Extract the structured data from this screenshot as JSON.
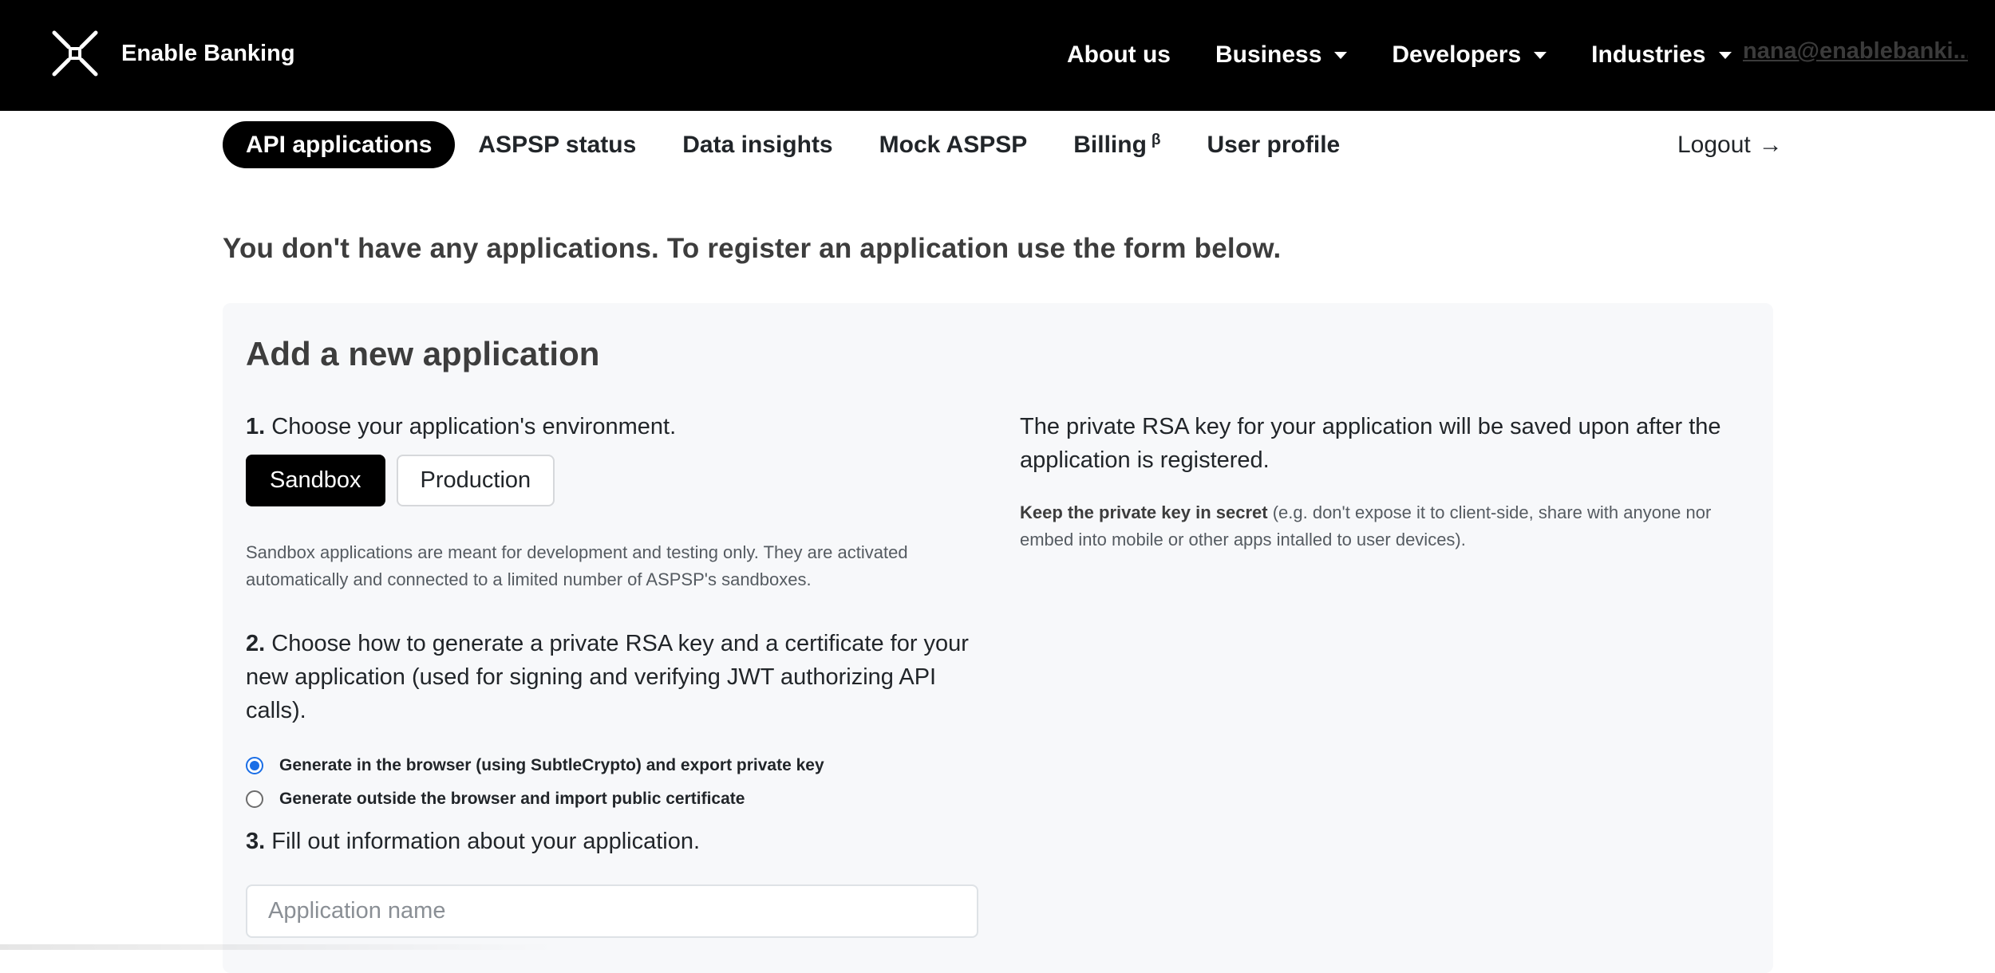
{
  "header": {
    "brand_name": "Enable Banking",
    "nav": [
      {
        "label": "About us",
        "has_caret": false
      },
      {
        "label": "Business",
        "has_caret": true
      },
      {
        "label": "Developers",
        "has_caret": true
      },
      {
        "label": "Industries",
        "has_caret": true
      }
    ],
    "user_email": "nana@enablebanki..."
  },
  "subnav": {
    "items": [
      {
        "label": "API applications",
        "active": true
      },
      {
        "label": "ASPSP status",
        "active": false
      },
      {
        "label": "Data insights",
        "active": false
      },
      {
        "label": "Mock ASPSP",
        "active": false
      },
      {
        "label": "Billing",
        "superscript": "β",
        "active": false
      },
      {
        "label": "User profile",
        "active": false
      }
    ],
    "logout_label": "Logout",
    "logout_arrow": "→"
  },
  "main": {
    "empty_message": "You don't have any applications. To register an application use the form below.",
    "form": {
      "title": "Add a new application",
      "step1": {
        "number": "1.",
        "text": "Choose your application's environment."
      },
      "environments": {
        "sandbox": "Sandbox",
        "production": "Production",
        "selected": "Sandbox"
      },
      "sandbox_help": "Sandbox applications are meant for development and testing only. They are activated automatically and connected to a limited number of ASPSP's sandboxes.",
      "step2": {
        "number": "2.",
        "text": "Choose how to generate a private RSA key and a certificate for your new application (used for signing and verifying JWT authorizing API calls)."
      },
      "key_options": [
        {
          "label": "Generate in the browser (using SubtleCrypto) and export private key",
          "checked": true
        },
        {
          "label": "Generate outside the browser and import public certificate",
          "checked": false
        }
      ],
      "step3": {
        "number": "3.",
        "text": "Fill out information about your application."
      },
      "app_name": {
        "value": "",
        "placeholder": "Application name"
      },
      "rsa_note": "The private RSA key for your application will be saved upon after the application is registered.",
      "secret_note_bold": "Keep the private key in secret",
      "secret_note_rest": " (e.g. don't expose it to client-side, share with anyone nor embed into mobile or other apps intalled to user devices)."
    }
  },
  "colors": {
    "header_bg": "#000000",
    "panel_bg": "#f7f8fa",
    "radio_accent": "#1a6ee6"
  }
}
